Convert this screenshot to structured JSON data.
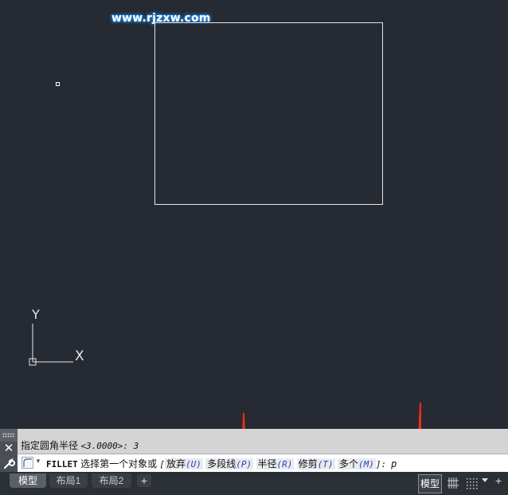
{
  "watermark": "www.rjzxw.com",
  "ucs": {
    "y_label": "Y",
    "x_label": "X"
  },
  "command": {
    "history": "指定圆角半径 ",
    "history_value": "<3.0000>: 3",
    "name": "FILLET",
    "prompt": " 选择第一个对象或 ",
    "bracket_open": "[",
    "options": [
      {
        "label": "放弃",
        "key": "(U)"
      },
      {
        "label": "多段线",
        "key": "(P)"
      },
      {
        "label": "半径",
        "key": "(R)"
      },
      {
        "label": "修剪",
        "key": "(T)"
      },
      {
        "label": "多个",
        "key": "(M)"
      }
    ],
    "bracket_close": "]:",
    "input": "p"
  },
  "tabs": [
    "模型",
    "布局1",
    "布局2"
  ],
  "tab_add": "+",
  "status": {
    "model": "模型"
  },
  "colors": {
    "canvas": "#252a33",
    "arrow": "#ff2a1a",
    "option_key": "#1e47b0"
  },
  "icons": [
    "close-icon",
    "wrench-icon",
    "fillet-command-icon",
    "grid-icon",
    "snap-grid-icon",
    "dropdown-icon",
    "plus-icon"
  ]
}
